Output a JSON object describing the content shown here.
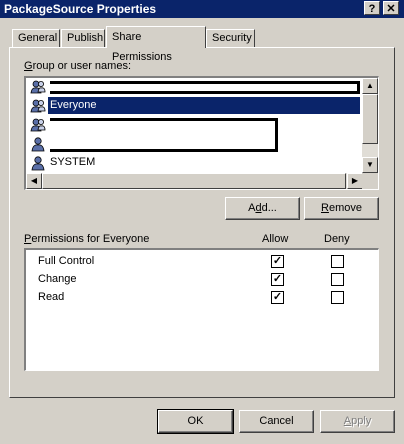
{
  "window": {
    "title": "PackageSource Properties",
    "help_glyph": "?",
    "close_glyph": "✕"
  },
  "tabs": [
    {
      "label": "General",
      "active": false
    },
    {
      "label": "Publish",
      "active": false
    },
    {
      "label": "Share Permissions",
      "active": true
    },
    {
      "label": "Security",
      "active": false
    }
  ],
  "users": {
    "label_accel": "G",
    "label_rest": "roup or user names:",
    "items": [
      {
        "name": "",
        "redacted": true,
        "selected": false
      },
      {
        "name": "Everyone",
        "redacted": false,
        "selected": true
      },
      {
        "name": "",
        "redacted": true,
        "selected": false
      },
      {
        "name": "",
        "redacted": true,
        "selected": false
      },
      {
        "name": "SYSTEM",
        "redacted": false,
        "selected": false
      }
    ]
  },
  "buttons": {
    "add_accel": "d",
    "add_pre": "A",
    "add_post": "d...",
    "remove_accel": "R",
    "remove_rest": "emove",
    "ok": "OK",
    "cancel": "Cancel",
    "apply_accel": "A",
    "apply_rest": "pply"
  },
  "permissions": {
    "label_accel": "P",
    "label_rest": "ermissions for Everyone",
    "allow_header": "Allow",
    "deny_header": "Deny",
    "rows": [
      {
        "name": "Full Control",
        "allow": true,
        "deny": false
      },
      {
        "name": "Change",
        "allow": true,
        "deny": false
      },
      {
        "name": "Read",
        "allow": true,
        "deny": false
      }
    ]
  },
  "colors": {
    "titlebar": "#0a246a",
    "face": "#d4d0c8",
    "selection": "#0a246a"
  }
}
